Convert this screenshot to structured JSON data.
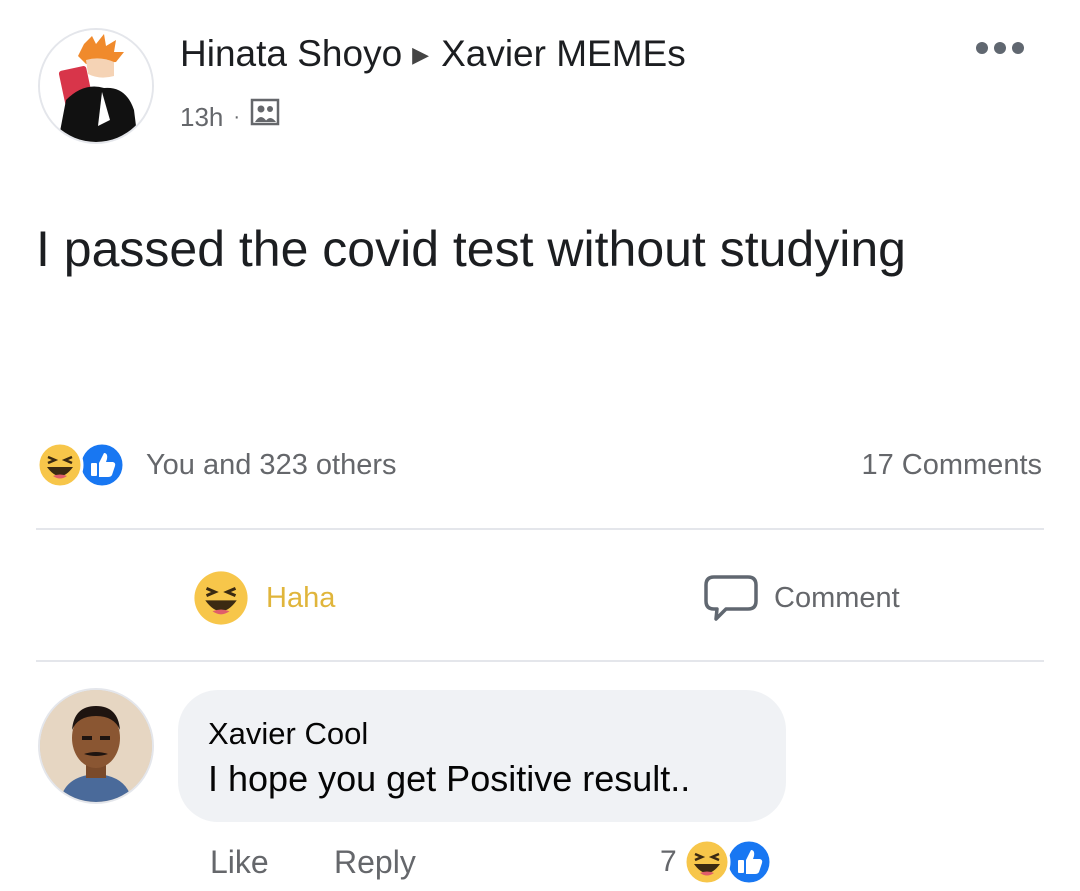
{
  "post": {
    "author": "Hinata Shoyo",
    "group": "Xavier MEMEs",
    "time": "13h",
    "privacy_icon": "photo-audience-icon",
    "text": "I passed the covid test without studying"
  },
  "reactions": {
    "icons": [
      "haha-icon",
      "like-icon"
    ],
    "summary": "You and 323 others",
    "comments_count": "17 Comments"
  },
  "actions": {
    "haha_label": "Haha",
    "comment_label": "Comment"
  },
  "comment": {
    "author": "Xavier Cool",
    "text": "I hope you get Positive result..",
    "like_label": "Like",
    "reply_label": "Reply",
    "reaction_count": "7"
  },
  "colors": {
    "haha": "#e0b53b",
    "like": "#1877f2",
    "secondary_text": "#65676b",
    "bubble": "#f0f2f5"
  }
}
